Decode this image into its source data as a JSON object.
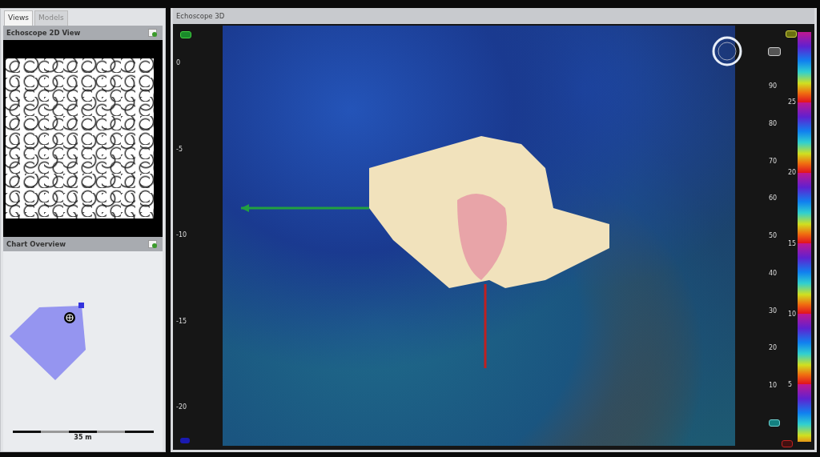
{
  "left_panel": {
    "tabs": [
      {
        "label": "Views",
        "selected": true
      },
      {
        "label": "Models",
        "selected": false
      }
    ],
    "panes": [
      {
        "kind": "image",
        "title": "Echoscope 2D View"
      },
      {
        "kind": "overview",
        "title": "Chart Overview",
        "scale_label": "35 m"
      }
    ]
  },
  "main_view": {
    "title": "Echoscope 3D",
    "depth_labels": [
      "0",
      "-5",
      "-10",
      "-15",
      "-20"
    ],
    "outer_scale": [
      "90",
      "80",
      "70",
      "60",
      "50",
      "40",
      "30",
      "20",
      "10"
    ],
    "inner_scale": [
      "25",
      "20",
      "15",
      "10",
      "5"
    ]
  }
}
